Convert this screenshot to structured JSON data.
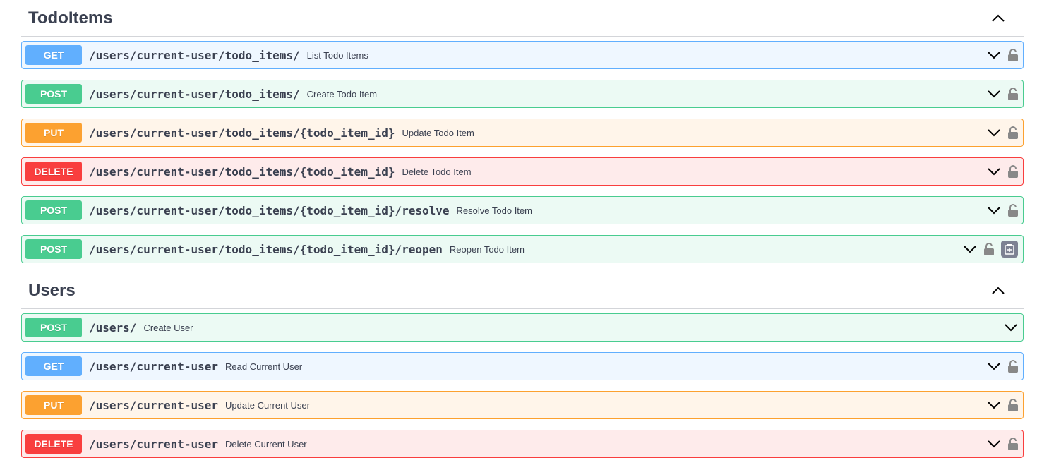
{
  "sections": [
    {
      "title": "TodoItems",
      "operations": [
        {
          "method": "GET",
          "path": "/users/current-user/todo_items/",
          "summary": "List Todo Items"
        },
        {
          "method": "POST",
          "path": "/users/current-user/todo_items/",
          "summary": "Create Todo Item"
        },
        {
          "method": "PUT",
          "path": "/users/current-user/todo_items/{todo_item_id}",
          "summary": "Update Todo Item"
        },
        {
          "method": "DELETE",
          "path": "/users/current-user/todo_items/{todo_item_id}",
          "summary": "Delete Todo Item"
        },
        {
          "method": "POST",
          "path": "/users/current-user/todo_items/{todo_item_id}/resolve",
          "summary": "Resolve Todo Item"
        },
        {
          "method": "POST",
          "path": "/users/current-user/todo_items/{todo_item_id}/reopen",
          "summary": "Reopen Todo Item"
        }
      ]
    },
    {
      "title": "Users",
      "operations": [
        {
          "method": "POST",
          "path": "/users/",
          "summary": "Create User"
        },
        {
          "method": "GET",
          "path": "/users/current-user",
          "summary": "Read Current User"
        },
        {
          "method": "PUT",
          "path": "/users/current-user",
          "summary": "Update Current User"
        },
        {
          "method": "DELETE",
          "path": "/users/current-user",
          "summary": "Delete Current User"
        }
      ]
    }
  ],
  "icons": {
    "section_toggle": "chevron-up-icon",
    "op_toggle": "chevron-down-icon",
    "auth": "lock-icon",
    "copy": "clipboard-icon"
  },
  "colors": {
    "get": "#61affe",
    "post": "#49cc90",
    "put": "#fca130",
    "delete": "#f93e3e",
    "text": "#3b4151"
  }
}
